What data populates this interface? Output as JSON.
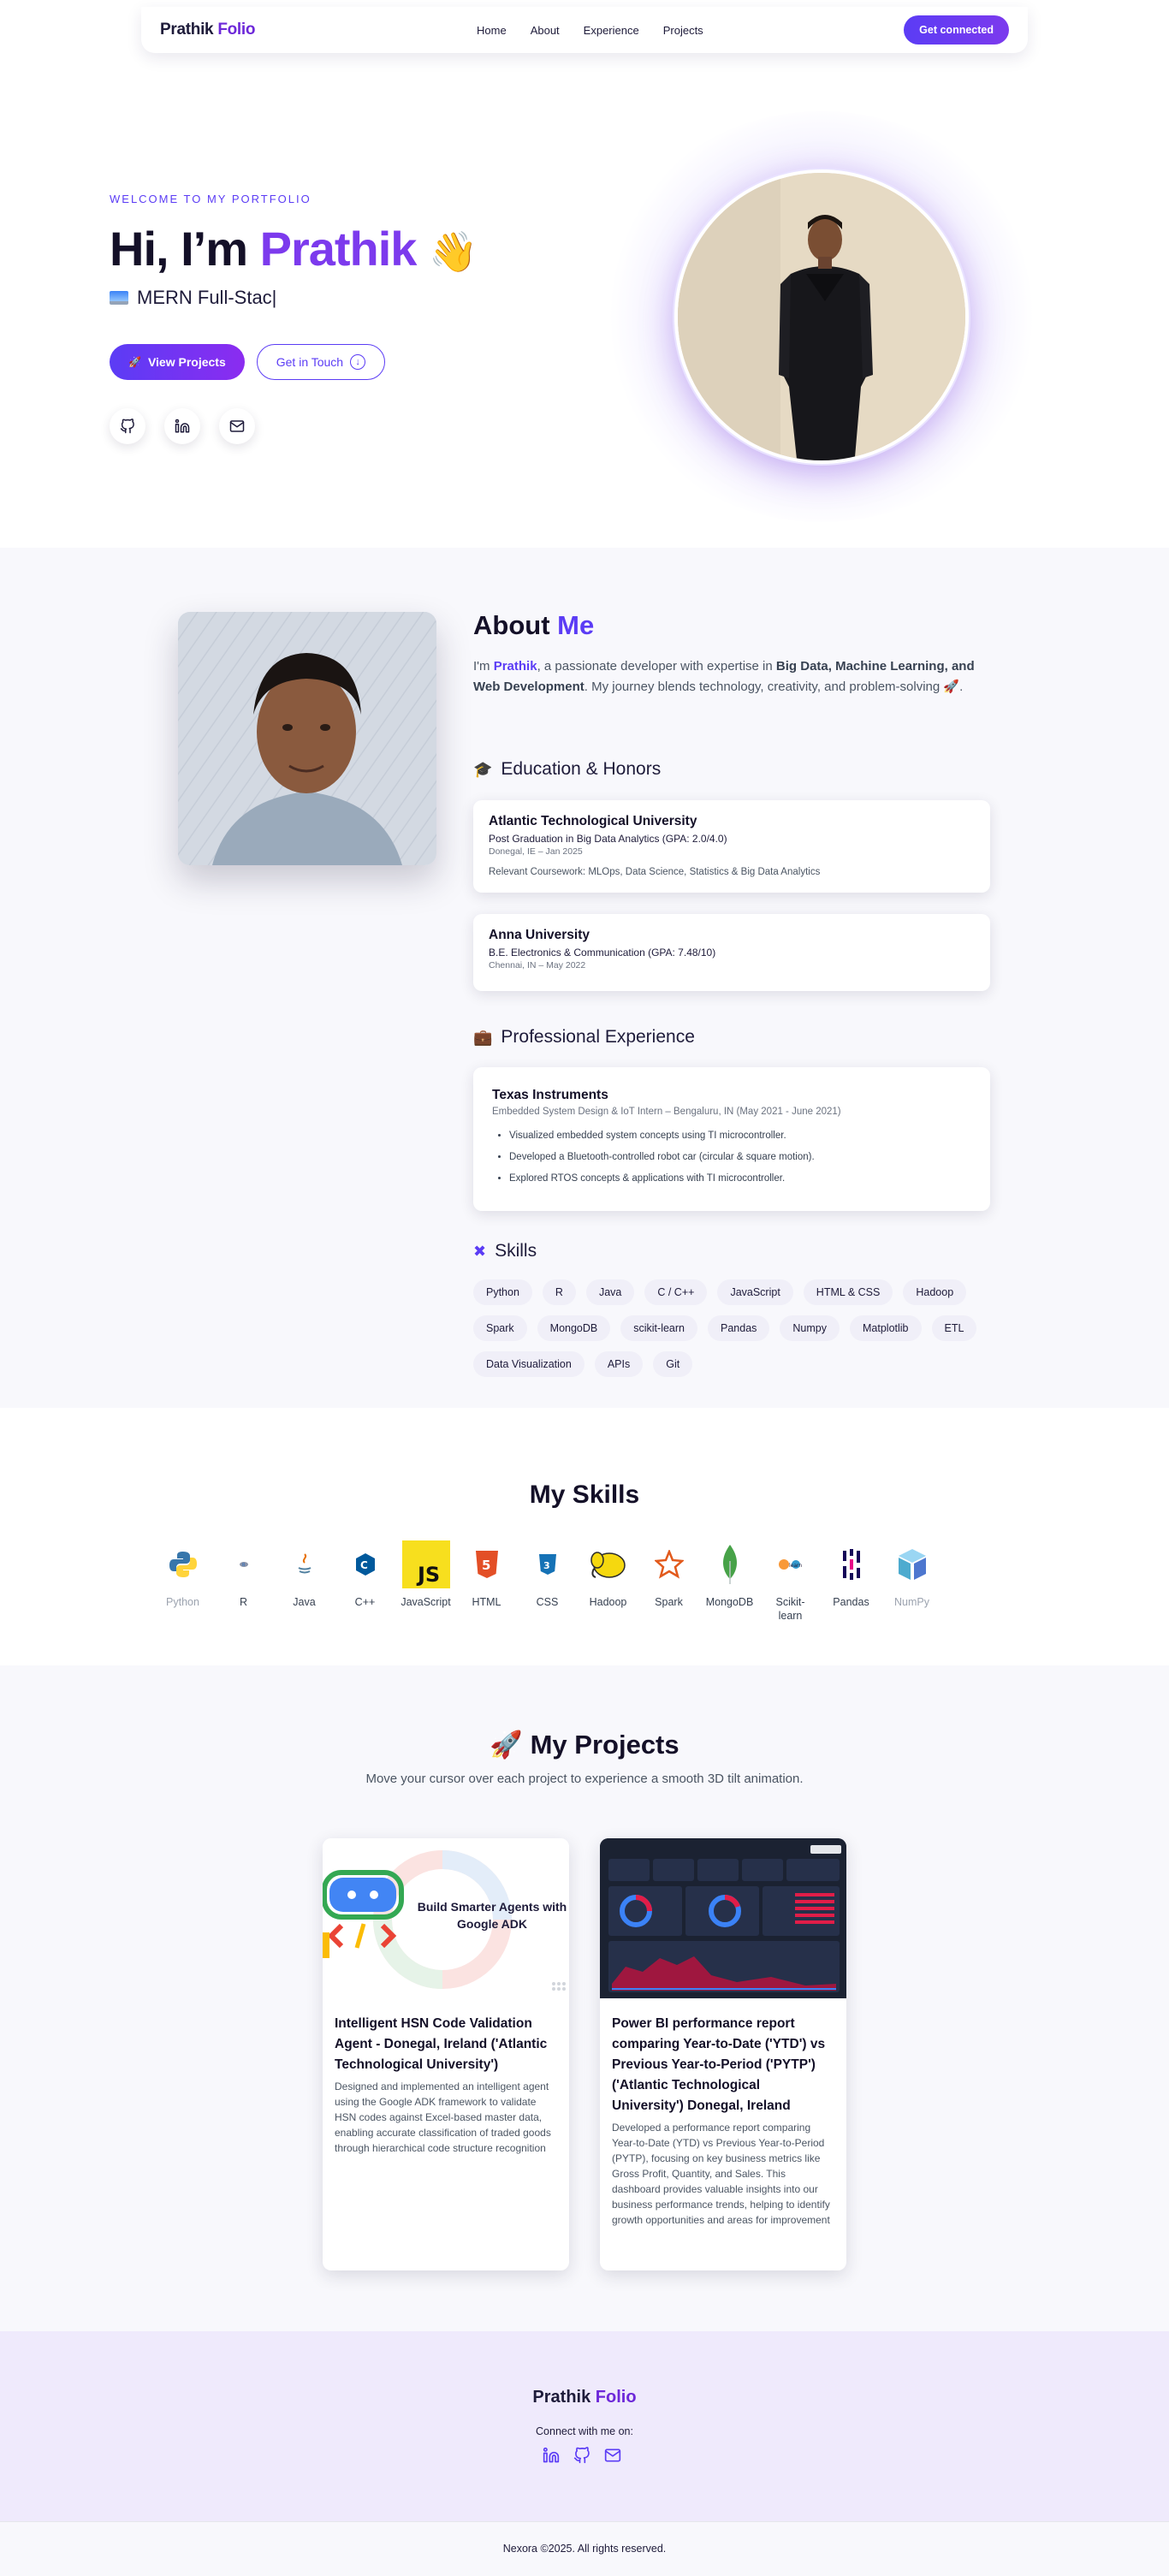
{
  "nav": {
    "brand_first": "Prathik",
    "brand_second": "Folio",
    "links": [
      "Home",
      "About",
      "Experience",
      "Projects"
    ],
    "cta": "Get connected"
  },
  "hero": {
    "welcome": "WELCOME TO MY PORTFOLIO",
    "greeting": "Hi, I’m",
    "name": "Prathik",
    "emoji": "👋",
    "typed_text": "MERN Full-Stac|",
    "btn_primary": "View Projects",
    "btn_secondary": "Get in Touch",
    "socials": [
      "github-icon",
      "linkedin-icon",
      "mail-icon"
    ]
  },
  "about": {
    "title_first": "About",
    "title_second": "Me",
    "text_1": "I'm ",
    "text_name": "Prathik",
    "text_2": ", a passionate developer with expertise in ",
    "text_bold": "Big Data, Machine Learning, and Web Development",
    "text_3": ". My journey blends technology, creativity, and problem-solving 🚀."
  },
  "education": {
    "heading": "Education & Honors",
    "items": [
      {
        "school": "Atlantic Technological University",
        "degree": "Post Graduation in Big Data Analytics (GPA: 2.0/4.0)",
        "meta": "Donegal, IE – Jan 2025",
        "extra": "Relevant Coursework: MLOps, Data Science, Statistics & Big Data Analytics"
      },
      {
        "school": "Anna University",
        "degree": "B.E. Electronics & Communication (GPA: 7.48/10)",
        "meta": "Chennai, IN – May 2022"
      }
    ]
  },
  "experience": {
    "heading": "Professional Experience",
    "company": "Texas Instruments",
    "role": "Embedded System Design & IoT Intern – Bengaluru, IN (May 2021 - June 2021)",
    "bullets": [
      "Visualized embedded system concepts using TI microcontroller.",
      "Developed a Bluetooth-controlled robot car (circular & square motion).",
      "Explored RTOS concepts & applications with TI microcontroller."
    ]
  },
  "skills_tags": {
    "heading": "Skills",
    "tags": [
      "Python",
      "R",
      "Java",
      "C / C++",
      "JavaScript",
      "HTML & CSS",
      "Hadoop",
      "Spark",
      "MongoDB",
      "scikit-learn",
      "Pandas",
      "Numpy",
      "Matplotlib",
      "ETL",
      "Data Visualization",
      "APIs",
      "Git"
    ]
  },
  "my_skills": {
    "title": "My Skills",
    "items": [
      {
        "label": "Python",
        "icon": "python-icon"
      },
      {
        "label": "R",
        "icon": "r-icon"
      },
      {
        "label": "Java",
        "icon": "java-icon"
      },
      {
        "label": "C++",
        "icon": "cpp-icon"
      },
      {
        "label": "JavaScript",
        "icon": "javascript-icon"
      },
      {
        "label": "HTML",
        "icon": "html-icon"
      },
      {
        "label": "CSS",
        "icon": "css-icon"
      },
      {
        "label": "Hadoop",
        "icon": "hadoop-icon"
      },
      {
        "label": "Spark",
        "icon": "spark-icon"
      },
      {
        "label": "MongoDB",
        "icon": "mongodb-icon"
      },
      {
        "label": "Scikit-learn",
        "icon": "scikit-learn-icon"
      },
      {
        "label": "Pandas",
        "icon": "pandas-icon"
      },
      {
        "label": "NumPy",
        "icon": "numpy-icon"
      }
    ]
  },
  "projects": {
    "title": "My Projects",
    "emoji": "🚀",
    "subtitle": "Move your cursor over each project to experience a smooth 3D tilt animation.",
    "items": [
      {
        "image_text": "Build Smarter Agents with Google ADK",
        "title": "Intelligent HSN Code Validation Agent - Donegal, Ireland ('Atlantic Technological University')",
        "desc": "Designed and implemented an intelligent agent using the Google ADK framework to validate HSN codes against Excel-based master data, enabling accurate classification of traded goods through hierarchical code structure recognition"
      },
      {
        "title": "Power BI performance report comparing Year-to-Date ('YTD') vs Previous Year-to-Period ('PYTP') ('Atlantic Technological University') Donegal, Ireland",
        "desc": "Developed a performance report comparing Year-to-Date (YTD) vs Previous Year-to-Period (PYTP), focusing on key business metrics like Gross Profit, Quantity, and Sales. This dashboard provides valuable insights into our business performance trends, helping to identify growth opportunities and areas for improvement"
      }
    ]
  },
  "footer": {
    "brand_first": "Prathik",
    "brand_second": "Folio",
    "connect": "Connect with me on:",
    "icons": [
      "linkedin-icon",
      "github-icon",
      "mail-icon"
    ],
    "copyright": "Nexora ©2025. All rights reserved."
  },
  "colors": {
    "accent": "#5b3cf5",
    "accent_2": "#7c3aed",
    "text": "#1e1b3a",
    "section_bg": "#f8f8fc",
    "footer_bg": "#efeafc"
  }
}
